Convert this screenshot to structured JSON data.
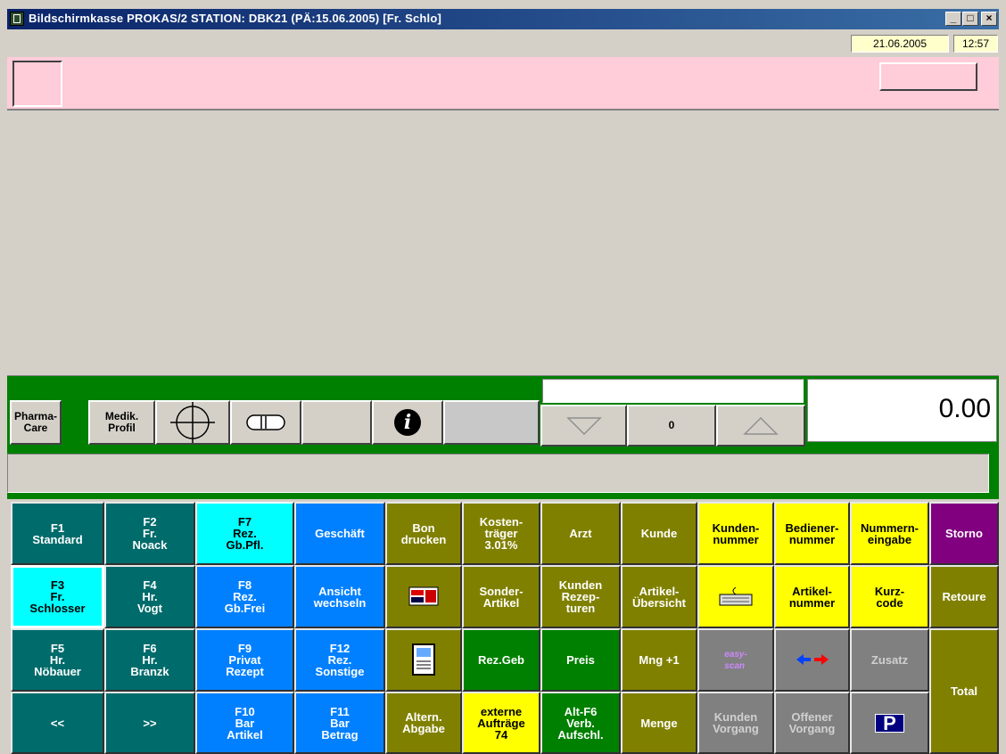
{
  "window": {
    "title": "Bildschirmkasse PROKAS/2  STATION: DBK21 (PÄ:15.06.2005) [Fr. Schlo]",
    "minimize": "_",
    "maximize": "□",
    "close": "×"
  },
  "status": {
    "date": "21.06.2005",
    "time": "12:57"
  },
  "toolbar": {
    "pharma_care": "Pharma-\nCare",
    "medik_profil": "Medik.\nProfil",
    "counter": "0",
    "amount": "0.00"
  },
  "buttons": [
    {
      "id": "f1",
      "label": "F1\nStandard",
      "color": "teal"
    },
    {
      "id": "f2",
      "label": "F2\nFr.\nNoack",
      "color": "teal"
    },
    {
      "id": "f7",
      "label": "F7\nRez.\nGb.Pfl.",
      "color": "cyan"
    },
    {
      "id": "geschaeft",
      "label": "Geschäft",
      "color": "blue"
    },
    {
      "id": "bon-drucken",
      "label": "Bon\ndrucken",
      "color": "olive"
    },
    {
      "id": "kostentraeger",
      "label": "Kosten-\nträger\n3.01%",
      "color": "olive"
    },
    {
      "id": "arzt",
      "label": "Arzt",
      "color": "olive"
    },
    {
      "id": "kunde",
      "label": "Kunde",
      "color": "olive"
    },
    {
      "id": "kundennummer",
      "label": "Kunden-\nnummer",
      "color": "yellow"
    },
    {
      "id": "bedienernummer",
      "label": "Bediener-\nnummer",
      "color": "yellow"
    },
    {
      "id": "nummerneingabe",
      "label": "Nummern-\neingabe",
      "color": "yellow"
    },
    {
      "id": "storno",
      "label": "Storno",
      "color": "purple"
    },
    {
      "id": "f3",
      "label": "F3\nFr.\nSchlosser",
      "color": "cyan"
    },
    {
      "id": "f4",
      "label": "F4\nHr.\nVogt",
      "color": "teal"
    },
    {
      "id": "f8",
      "label": "F8\nRez.\nGb.Frei",
      "color": "blue"
    },
    {
      "id": "ansicht-wechseln",
      "label": "Ansicht\nwechseln",
      "color": "blue"
    },
    {
      "id": "card",
      "label": "",
      "color": "olive"
    },
    {
      "id": "sonder-artikel",
      "label": "Sonder-\nArtikel",
      "color": "olive"
    },
    {
      "id": "kunden-rezepturen",
      "label": "Kunden\nRezep-\nturen",
      "color": "olive"
    },
    {
      "id": "artikel-uebersicht",
      "label": "Artikel-\nÜbersicht",
      "color": "olive"
    },
    {
      "id": "keyboard",
      "label": "",
      "color": "yellow"
    },
    {
      "id": "artikelnummer",
      "label": "Artikel-\nnummer",
      "color": "yellow"
    },
    {
      "id": "kurzcode",
      "label": "Kurz-\ncode",
      "color": "yellow"
    },
    {
      "id": "retoure",
      "label": "Retoure",
      "color": "olive"
    },
    {
      "id": "f5",
      "label": "F5\nHr.\nNöbauer",
      "color": "teal"
    },
    {
      "id": "f6",
      "label": "F6\nHr.\nBranzk",
      "color": "teal"
    },
    {
      "id": "f9",
      "label": "F9\nPrivat\nRezept",
      "color": "blue"
    },
    {
      "id": "f12",
      "label": "F12\nRez.\nSonstige",
      "color": "blue"
    },
    {
      "id": "document",
      "label": "",
      "color": "olive"
    },
    {
      "id": "rez-geb",
      "label": "Rez.Geb",
      "color": "green"
    },
    {
      "id": "preis",
      "label": "Preis",
      "color": "green"
    },
    {
      "id": "mng-plus-1",
      "label": "Mng +1",
      "color": "olive"
    },
    {
      "id": "easyscan",
      "label": "easy-\nscan",
      "color": "grey"
    },
    {
      "id": "arrows",
      "label": "",
      "color": "grey"
    },
    {
      "id": "zusatz",
      "label": "Zusatz",
      "color": "grey"
    },
    {
      "id": "total",
      "label": "Total",
      "color": "olive"
    },
    {
      "id": "prev",
      "label": "<<",
      "color": "teal"
    },
    {
      "id": "next",
      "label": ">>",
      "color": "teal"
    },
    {
      "id": "f10",
      "label": "F10\nBar\nArtikel",
      "color": "blue"
    },
    {
      "id": "f11",
      "label": "F11\nBar\nBetrag",
      "color": "blue"
    },
    {
      "id": "altern-abgabe",
      "label": "Altern.\nAbgabe",
      "color": "olive"
    },
    {
      "id": "externe-auftraege",
      "label": "externe\nAufträge\n74",
      "color": "yellow"
    },
    {
      "id": "alt-f6",
      "label": "Alt-F6\nVerb.\nAufschl.",
      "color": "green"
    },
    {
      "id": "menge",
      "label": "Menge",
      "color": "olive"
    },
    {
      "id": "kunden-vorgang",
      "label": "Kunden\nVorgang",
      "color": "grey"
    },
    {
      "id": "offener-vorgang",
      "label": "Offener\nVorgang",
      "color": "grey"
    },
    {
      "id": "parking",
      "label": "P",
      "color": "grey"
    }
  ]
}
